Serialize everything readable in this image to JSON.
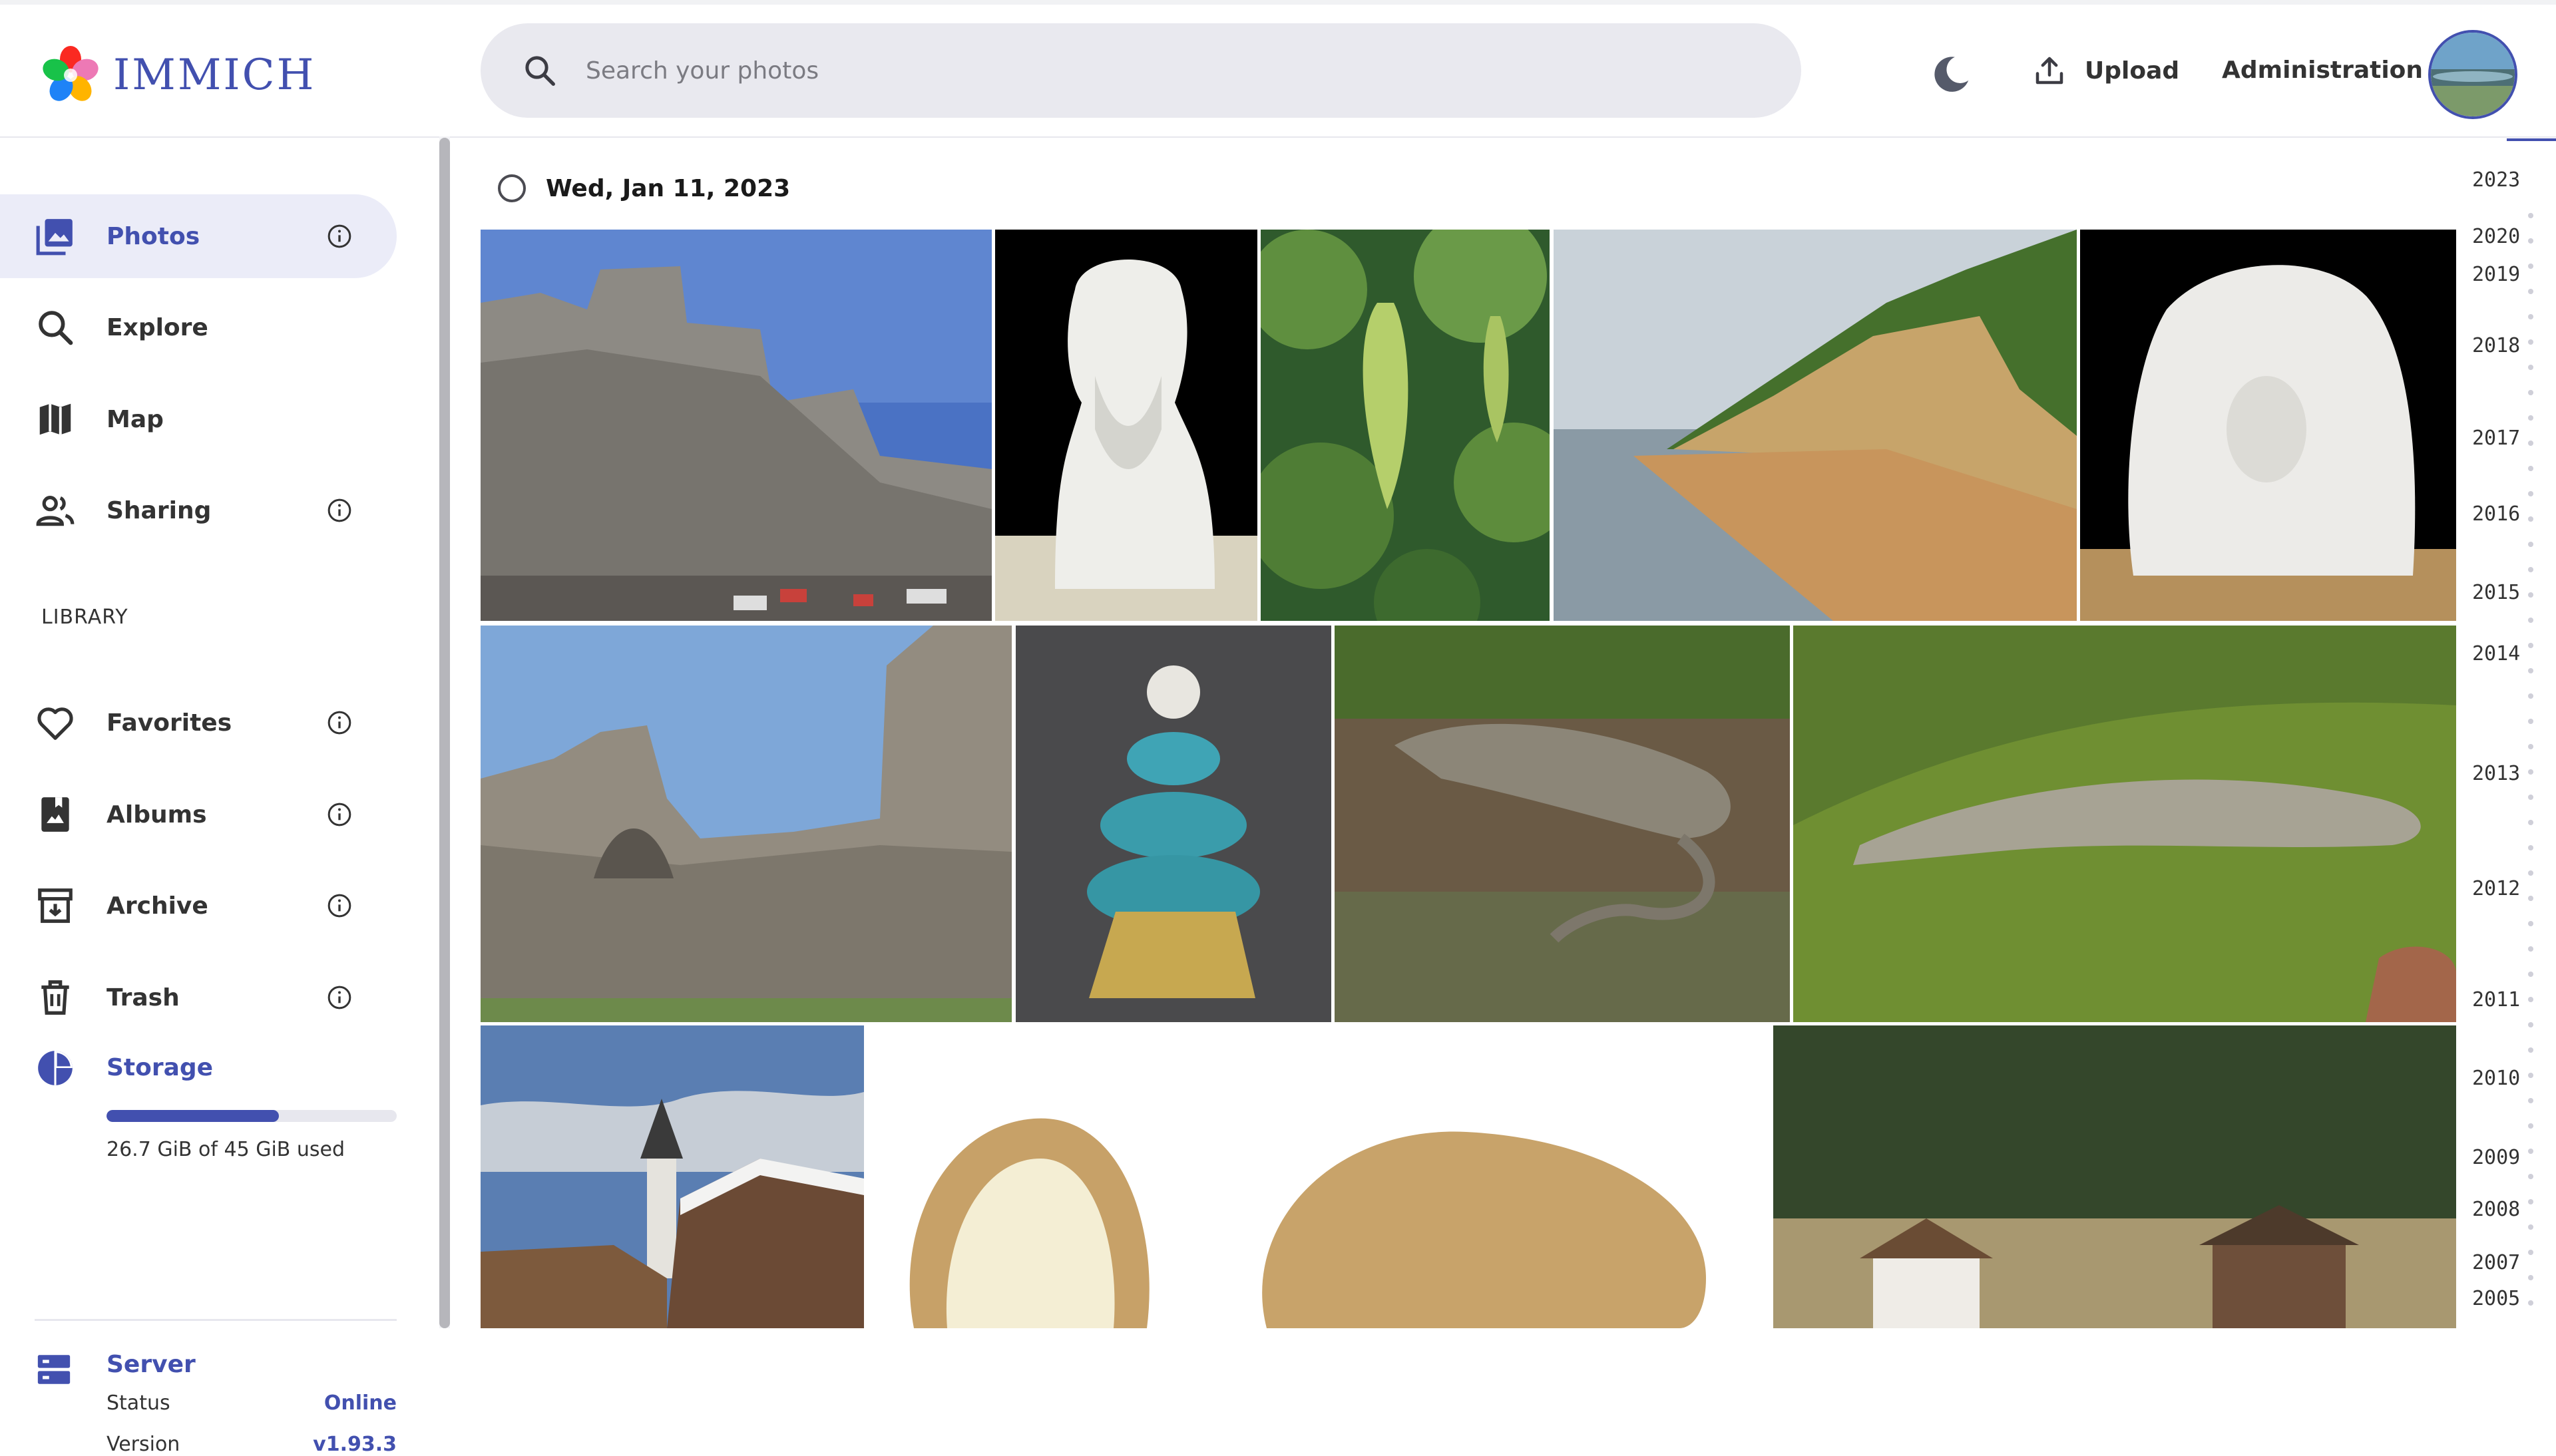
{
  "app": {
    "name": "IMMICH"
  },
  "header": {
    "search_placeholder": "Search your photos",
    "upload_label": "Upload",
    "admin_label": "Administration"
  },
  "sidebar": {
    "items": [
      {
        "label": "Photos",
        "icon": "photos-icon",
        "active": true,
        "info": true
      },
      {
        "label": "Explore",
        "icon": "explore-icon",
        "active": false,
        "info": false
      },
      {
        "label": "Map",
        "icon": "map-icon",
        "active": false,
        "info": false
      },
      {
        "label": "Sharing",
        "icon": "sharing-icon",
        "active": false,
        "info": true
      }
    ],
    "library_title": "LIBRARY",
    "library_items": [
      {
        "label": "Favorites",
        "icon": "heart-icon",
        "info": true
      },
      {
        "label": "Albums",
        "icon": "album-icon",
        "info": true
      },
      {
        "label": "Archive",
        "icon": "archive-icon",
        "info": true
      },
      {
        "label": "Trash",
        "icon": "trash-icon",
        "info": true
      }
    ],
    "storage": {
      "title": "Storage",
      "used_text": "26.7 GiB of 45 GiB used",
      "used_fraction": 0.593
    },
    "server": {
      "title": "Server",
      "status_label": "Status",
      "status_value": "Online",
      "version_label": "Version",
      "version_value": "v1.93.3"
    }
  },
  "timeline": {
    "date_group": "Wed, Jan 11, 2023",
    "years": [
      "2023",
      "2020",
      "2019",
      "2018",
      "2017",
      "2016",
      "2015",
      "2014",
      "2013",
      "2012",
      "2011",
      "2010",
      "2009",
      "2008",
      "2007",
      "2005"
    ]
  },
  "photos": [
    {
      "name": "photo-fortress-walls",
      "subject": "fortress"
    },
    {
      "name": "photo-marble-bust",
      "subject": "bust"
    },
    {
      "name": "photo-sea-grapes",
      "subject": "grapes"
    },
    {
      "name": "photo-coastal-cliff",
      "subject": "cliff"
    },
    {
      "name": "photo-marble-sculpture",
      "subject": "sculpture"
    },
    {
      "name": "photo-castle-ruins",
      "subject": "ruins"
    },
    {
      "name": "photo-porcelain-centerpiece",
      "subject": "porcelain"
    },
    {
      "name": "photo-lizard-on-leaves",
      "subject": "lizard1"
    },
    {
      "name": "photo-lizard-on-moss",
      "subject": "lizard2"
    },
    {
      "name": "photo-snowy-church",
      "subject": "church"
    },
    {
      "name": "photo-potatoes",
      "subject": "potatoes"
    },
    {
      "name": "photo-alpine-houses",
      "subject": "alpine"
    }
  ],
  "colors": {
    "accent": "#4250af",
    "active_bg": "#ebecf8"
  }
}
